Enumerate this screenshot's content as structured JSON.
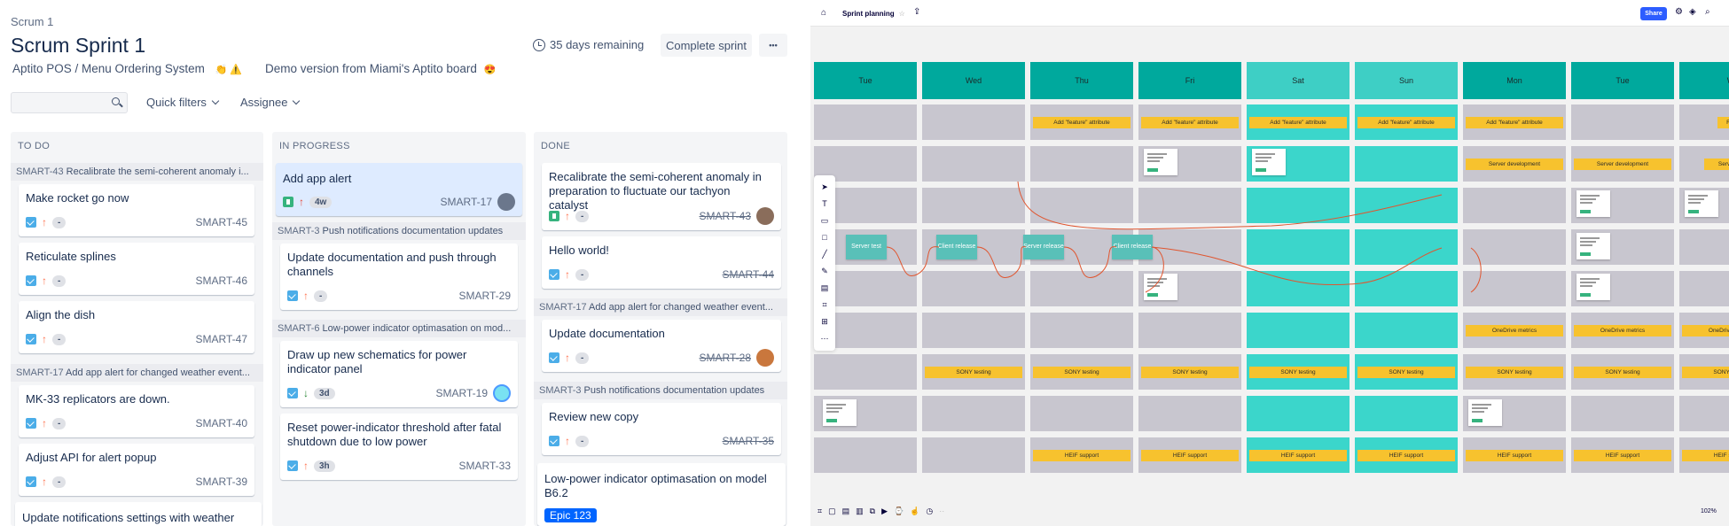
{
  "jira": {
    "breadcrumb": "Scrum 1",
    "title": "Scrum Sprint 1",
    "days_remaining": "35 days remaining",
    "complete_sprint": "Complete sprint",
    "more": "•••",
    "project": "Aptito POS / Menu Ordering System",
    "project_emoji": "👏 ⚠️",
    "demo": "Demo version from Miami's Aptito board",
    "demo_emoji": "😍",
    "quick_filters": "Quick filters",
    "assignee": "Assignee",
    "columns": {
      "todo": {
        "header": "TO DO",
        "swim1_key": "SMART-43",
        "swim1_text": "Recalibrate the semi-coherent anomaly i...",
        "swim2_key": "SMART-17",
        "swim2_text": "Add app alert for changed weather event...",
        "cards": [
          {
            "title": "Make rocket go now",
            "key": "SMART-45",
            "pill": "-"
          },
          {
            "title": "Reticulate splines",
            "key": "SMART-46",
            "pill": "-"
          },
          {
            "title": "Align the dish",
            "key": "SMART-47",
            "pill": "-"
          },
          {
            "title": "MK-33 replicators are down.",
            "key": "SMART-40",
            "pill": "-"
          },
          {
            "title": "Adjust API for alert popup",
            "key": "SMART-39",
            "pill": "-"
          },
          {
            "title": "Update notifications settings with weather"
          }
        ]
      },
      "inprogress": {
        "header": "IN PROGRESS",
        "swim1_key": "SMART-3",
        "swim1_text": "Push notifications documentation updates",
        "swim2_key": "SMART-6",
        "swim2_text": "Low-power indicator optimasation on mod...",
        "cards": [
          {
            "title": "Add app alert",
            "key": "SMART-17",
            "pill": "4w"
          },
          {
            "title": "Update documentation and push through channels",
            "key": "SMART-29",
            "pill": "-"
          },
          {
            "title": "Draw up new schematics for power indicator panel",
            "key": "SMART-19",
            "pill": "3d"
          },
          {
            "title": "Reset power-indicator threshold after fatal shutdown due to low power",
            "key": "SMART-33",
            "pill": "3h"
          }
        ]
      },
      "done": {
        "header": "DONE",
        "swim1_key": "SMART-17",
        "swim1_text": "Add app alert for changed weather event...",
        "swim2_key": "SMART-3",
        "swim2_text": "Push notifications documentation updates",
        "cards": [
          {
            "title": "Recalibrate the semi-coherent anomaly in preparation to fluctuate our tachyon catalyst",
            "key": "SMART-43",
            "pill": "-"
          },
          {
            "title": "Hello world!",
            "key": "SMART-44",
            "pill": "-"
          },
          {
            "title": "Update documentation",
            "key": "SMART-28",
            "pill": "-"
          },
          {
            "title": "Review new copy",
            "key": "SMART-35",
            "pill": "-"
          },
          {
            "title": "Low-power indicator optimasation on model B6.2"
          }
        ],
        "epic": "Epic 123"
      }
    }
  },
  "miro": {
    "board_name": "Sprint planning",
    "share": "Share",
    "zoom": "102%",
    "days": [
      "Tue",
      "Wed",
      "Thu",
      "Fri",
      "Sat",
      "Sun",
      "Mon",
      "Tue",
      "W"
    ],
    "stickies": {
      "feature": "Add \"feature\" attribute",
      "server_dev": "Server development",
      "server_dev_short": "Server de",
      "onedrive": "OneDrive metrics",
      "sony": "SONY testing",
      "heif": "HEIF support"
    },
    "teal_notes": {
      "server_test": "Server test",
      "client_release": "Client release",
      "server_release": "Server release",
      "client_release_2": "Client release"
    },
    "colors": {
      "header": "#00a99d",
      "header_weekend": "#3ecfc5",
      "cell": "#c8c6cf",
      "cell_weekend": "#3bd6cb",
      "sticky": "#f7c22e",
      "connector": "#e0552f",
      "share": "#2d5dff"
    }
  }
}
